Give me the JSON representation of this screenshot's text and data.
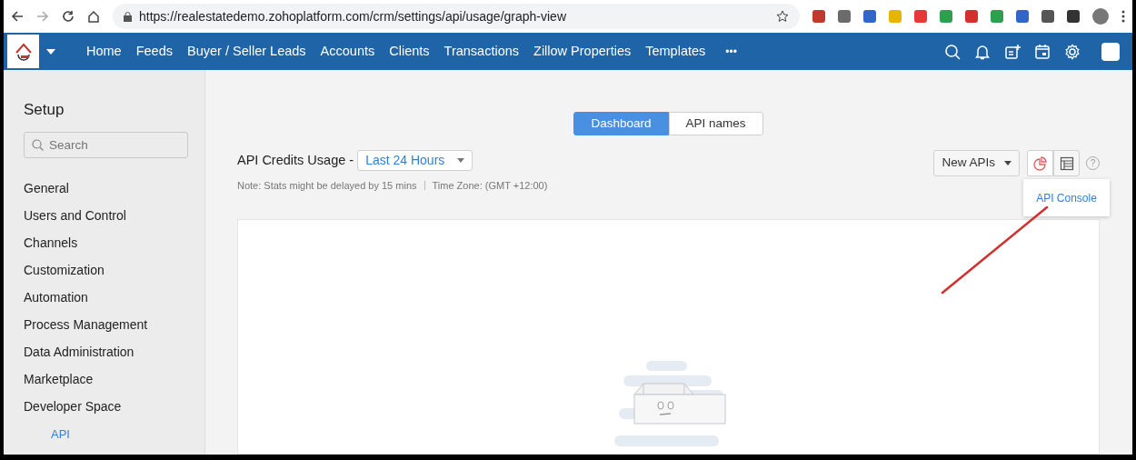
{
  "browser": {
    "url": "https://realestatedemo.zohoplatform.com/crm/settings/api/usage/graph-view",
    "extensions": [
      {
        "color": "#c0392b"
      },
      {
        "color": "#6b6b6b"
      },
      {
        "color": "#2f66c8"
      },
      {
        "color": "#e8b400"
      },
      {
        "color": "#e53935"
      },
      {
        "color": "#2e9e4f"
      },
      {
        "color": "#d32f2f"
      },
      {
        "color": "#2e9e4f"
      },
      {
        "color": "#2f66c8"
      },
      {
        "color": "#555555"
      },
      {
        "color": "#333333"
      }
    ]
  },
  "navbar": {
    "items": [
      "Home",
      "Feeds",
      "Buyer / Seller Leads",
      "Accounts",
      "Clients",
      "Transactions",
      "Zillow Properties",
      "Templates"
    ],
    "more": "•••"
  },
  "sidebar": {
    "title": "Setup",
    "search": {
      "placeholder": "Search"
    },
    "items": [
      "General",
      "Users and Control",
      "Channels",
      "Customization",
      "Automation",
      "Process Management",
      "Data Administration",
      "Marketplace",
      "Developer Space"
    ],
    "sub_item": "API"
  },
  "tabs": [
    {
      "label": "Dashboard",
      "selected": true
    },
    {
      "label": "API names",
      "selected": false
    }
  ],
  "usage": {
    "title": "API Credits Usage -",
    "period": "Last 24 Hours",
    "note": "Note: Stats might be delayed by 15 mins",
    "time_zone": "Time Zone: (GMT +12:00)"
  },
  "toolbar": {
    "filter": "New APIs",
    "views": [
      {
        "kind": "chart",
        "selected": true
      },
      {
        "kind": "table",
        "selected": false
      }
    ],
    "help": "?"
  },
  "popover": {
    "link": "API Console"
  }
}
